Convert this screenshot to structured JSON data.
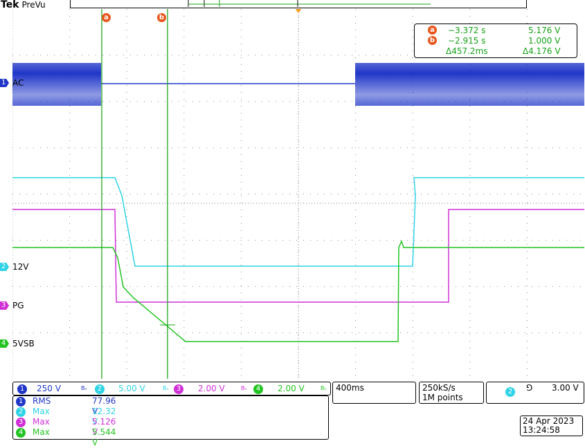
{
  "brand": "Tek",
  "mode": "PreVu",
  "cursors": {
    "a": {
      "label": "a",
      "time": "−3.372 s",
      "value": "5.176 V"
    },
    "b": {
      "label": "b",
      "time": "−2.915 s",
      "value": "1.000 V"
    },
    "delta_time": "Δ457.2ms",
    "delta_value": "Δ4.176 V"
  },
  "channels": [
    {
      "num": "1",
      "name": "AC",
      "scale": "250 V",
      "color": "#1f36c8"
    },
    {
      "num": "2",
      "name": "12V",
      "scale": "5.00 V",
      "color": "#2ed3e6"
    },
    {
      "num": "3",
      "name": "PG",
      "scale": "2.00 V",
      "color": "#d12fd6"
    },
    {
      "num": "4",
      "name": "5VSB",
      "scale": "2.00 V",
      "color": "#22c422"
    }
  ],
  "bw_marker": "Bᵥ",
  "timebase": "400ms",
  "sample_rate": "250kS/s",
  "record_length": "1M points",
  "trigger": {
    "source": "2",
    "slope": "⅁",
    "level": "3.00 V"
  },
  "measurements": [
    {
      "num": "1",
      "name": "RMS",
      "value": "77.96 V",
      "color": "#1f36c8"
    },
    {
      "num": "2",
      "name": "Max",
      "value": "12.32 V",
      "color": "#2ed3e6"
    },
    {
      "num": "3",
      "name": "Max",
      "value": "5.126 V",
      "color": "#d12fd6"
    },
    {
      "num": "4",
      "name": "Max",
      "value": "5.544 V",
      "color": "#22c422"
    }
  ],
  "date": "24 Apr 2023",
  "time": "13:24:58"
}
